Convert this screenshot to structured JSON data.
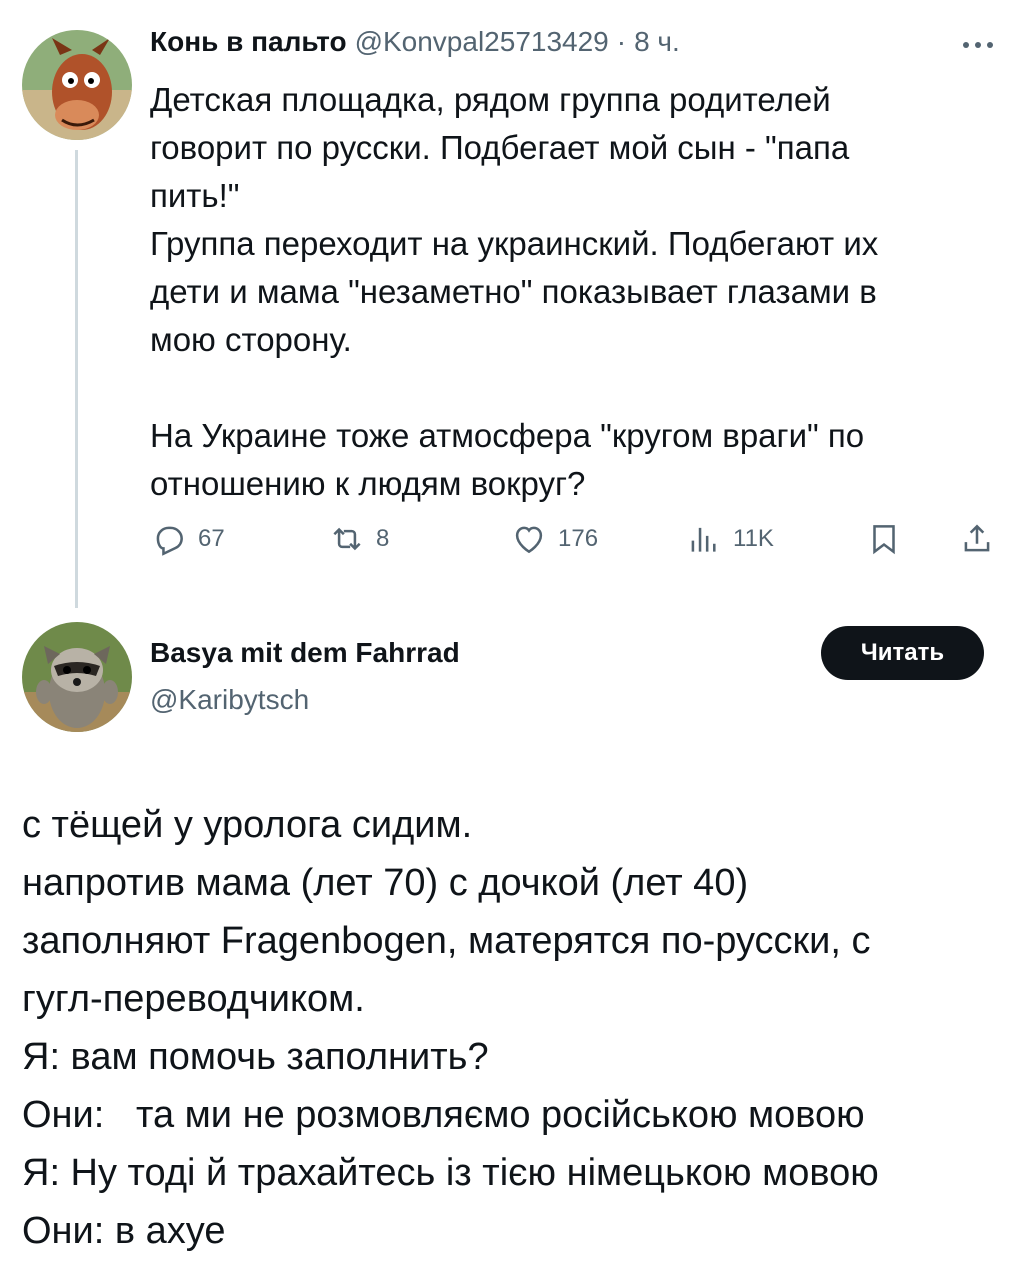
{
  "tweet1": {
    "author_name": "Конь в пальто",
    "handle": "@Konvpal25713429",
    "dot": "·",
    "time": "8 ч.",
    "more_icon": "more-icon",
    "text": "Детская площадка, рядом группа родителей\nговорит по русски. Подбегает мой сын - \"папа\nпить!\"\nГруппа переходит на украинский. Подбегают их\nдети и мама \"незаметно\" показывает глазами в\nмою сторону.\n\nНа Украине тоже атмосфера \"кругом враги\" по\nотношению к людям вокруг?",
    "actions": {
      "replies": "67",
      "reposts": "8",
      "likes": "176",
      "views": "11K"
    }
  },
  "tweet2": {
    "author_name": "Basya mit dem Fahrrad",
    "handle": "@Karibytsch",
    "follow_label": "Читать",
    "lines": [
      "с тёщей у уролога сидим.",
      "напротив мама (лет 70) с дочкой (лет 40)",
      "заполняют Fragenbogen, матерятся по-русски, с",
      "гугл-переводчиком.",
      "Я: вам помочь заполнить?",
      "Они:   та ми не розмовляємо російською мовою",
      "Я: Ну тоді й трахайтесь із тією німецькою мовою",
      "Они: в ахуе"
    ]
  },
  "colors": {
    "text": "#0f1419",
    "secondary": "#536471",
    "thread_line": "#cfd9de",
    "button_bg": "#0f1419"
  }
}
